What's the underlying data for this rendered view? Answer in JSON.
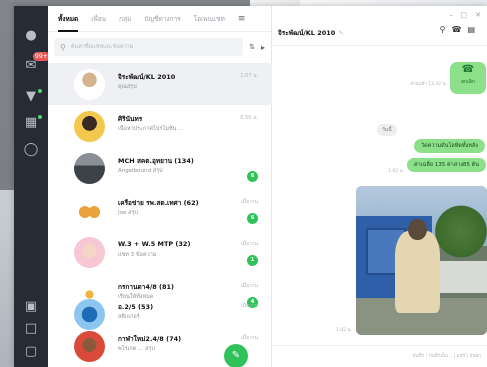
{
  "tabs": [
    {
      "label": "ทั้งหมด",
      "active": true
    },
    {
      "label": "เพื่อน",
      "active": false
    },
    {
      "label": "กลุ่ม",
      "active": false
    },
    {
      "label": "บัญชีทางการ",
      "active": false
    },
    {
      "label": "โอเพนแชท",
      "active": false
    }
  ],
  "search": {
    "placeholder": "ค้นหาชื่อแชทและข้อความ"
  },
  "rail": {
    "badge": "99+"
  },
  "chats": [
    {
      "name": "จิระพัฒน์/KL 2010",
      "preview": "คุณสรุป",
      "time": "1.07 น.",
      "count": ""
    },
    {
      "name": "ศิรินันทร",
      "preview": "เนื้อหาประกาศโปรโมชัน ...",
      "time": "0.50 น.",
      "count": ""
    },
    {
      "name": "MCH สคต.อุทยาน (134)",
      "preview": "Angelbound สรุป",
      "time": "",
      "count": "6"
    },
    {
      "name": "เครือข่าย รพ.สต.เทศา (62)",
      "preview": "Joe สรุป",
      "time": "เมื่อวาน",
      "count": "6"
    },
    {
      "name": "W.3 + W.5 MTP (32)",
      "preview": "แชท 3 ข้อความ",
      "time": "เมื่อวาน",
      "count": "1"
    },
    {
      "name": "กรกานดา4/8 (81)",
      "preview": "เรียนให้ทั้งหมด",
      "time": "เมื่อวาน",
      "count": "4"
    },
    {
      "name": "อ.2/5 (53)",
      "preview": "สติกเกอร์",
      "time": "เมื่อวาน",
      "count": ""
    },
    {
      "name": "กาฬาใหม่2.4/8 (74)",
      "preview": "พโรเกต ... สรุป",
      "time": "เมื่อวาน",
      "count": ""
    }
  ],
  "conversation": {
    "title": "จิระพัฒน์/KL 2010",
    "call_label": "ยกเลิก",
    "call_meta": "อ่านแล้ว 13.42 น.",
    "date_pill": "วันนี้",
    "bubble1": "วัดความดันโลหิตทั้งหลัง",
    "bubble2": "ค่าเฉลี่ย 135 ค่าล่าง85 ต้น",
    "bubble_meta": "1.02 น.",
    "photo_meta": "1.02 น.",
    "footer_text": "บันทึก ! บันทึกเป็น... | แชร์ | บันทุก"
  }
}
